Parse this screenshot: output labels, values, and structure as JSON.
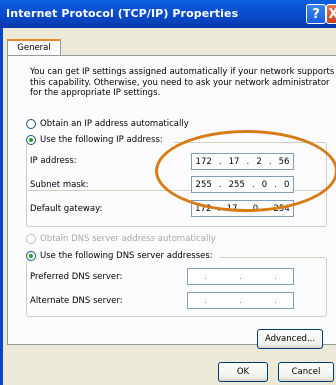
{
  "window": {
    "title": "Internet Protocol (TCP/IP) Properties",
    "help_label": "?",
    "close_label": "X"
  },
  "tabs": [
    {
      "label": "General",
      "selected": true
    }
  ],
  "intro_text": "You can get IP settings assigned automatically if your network supports this capability. Otherwise, you need to ask your network administrator for the appropriate IP settings.",
  "ip_mode": {
    "auto_label": "Obtain an IP address automatically",
    "manual_label": "Use the following IP address:",
    "selected": "manual"
  },
  "ip_fields": [
    {
      "label": "IP address:",
      "octets": [
        "172",
        "17",
        "2",
        "56"
      ]
    },
    {
      "label": "Subnet mask:",
      "octets": [
        "255",
        "255",
        "0",
        "0"
      ]
    },
    {
      "label": "Default gateway:",
      "octets": [
        "172",
        "17",
        "0",
        "254"
      ]
    }
  ],
  "dns_mode": {
    "auto_label": "Obtain DNS server address automatically",
    "manual_label": "Use the following DNS server addresses:",
    "selected": "manual"
  },
  "dns_fields": [
    {
      "label": "Preferred DNS server:",
      "octets": [
        ".",
        ".",
        "."
      ]
    },
    {
      "label": "Alternate DNS server:",
      "octets": [
        ".",
        ".",
        "."
      ]
    }
  ],
  "buttons": {
    "advanced": "Advanced...",
    "ok": "OK",
    "cancel": "Cancel"
  },
  "colors": {
    "titlebar": "#0a48c8",
    "highlight_ring": "#d87a15",
    "dialog_bg": "#ece9d8"
  }
}
